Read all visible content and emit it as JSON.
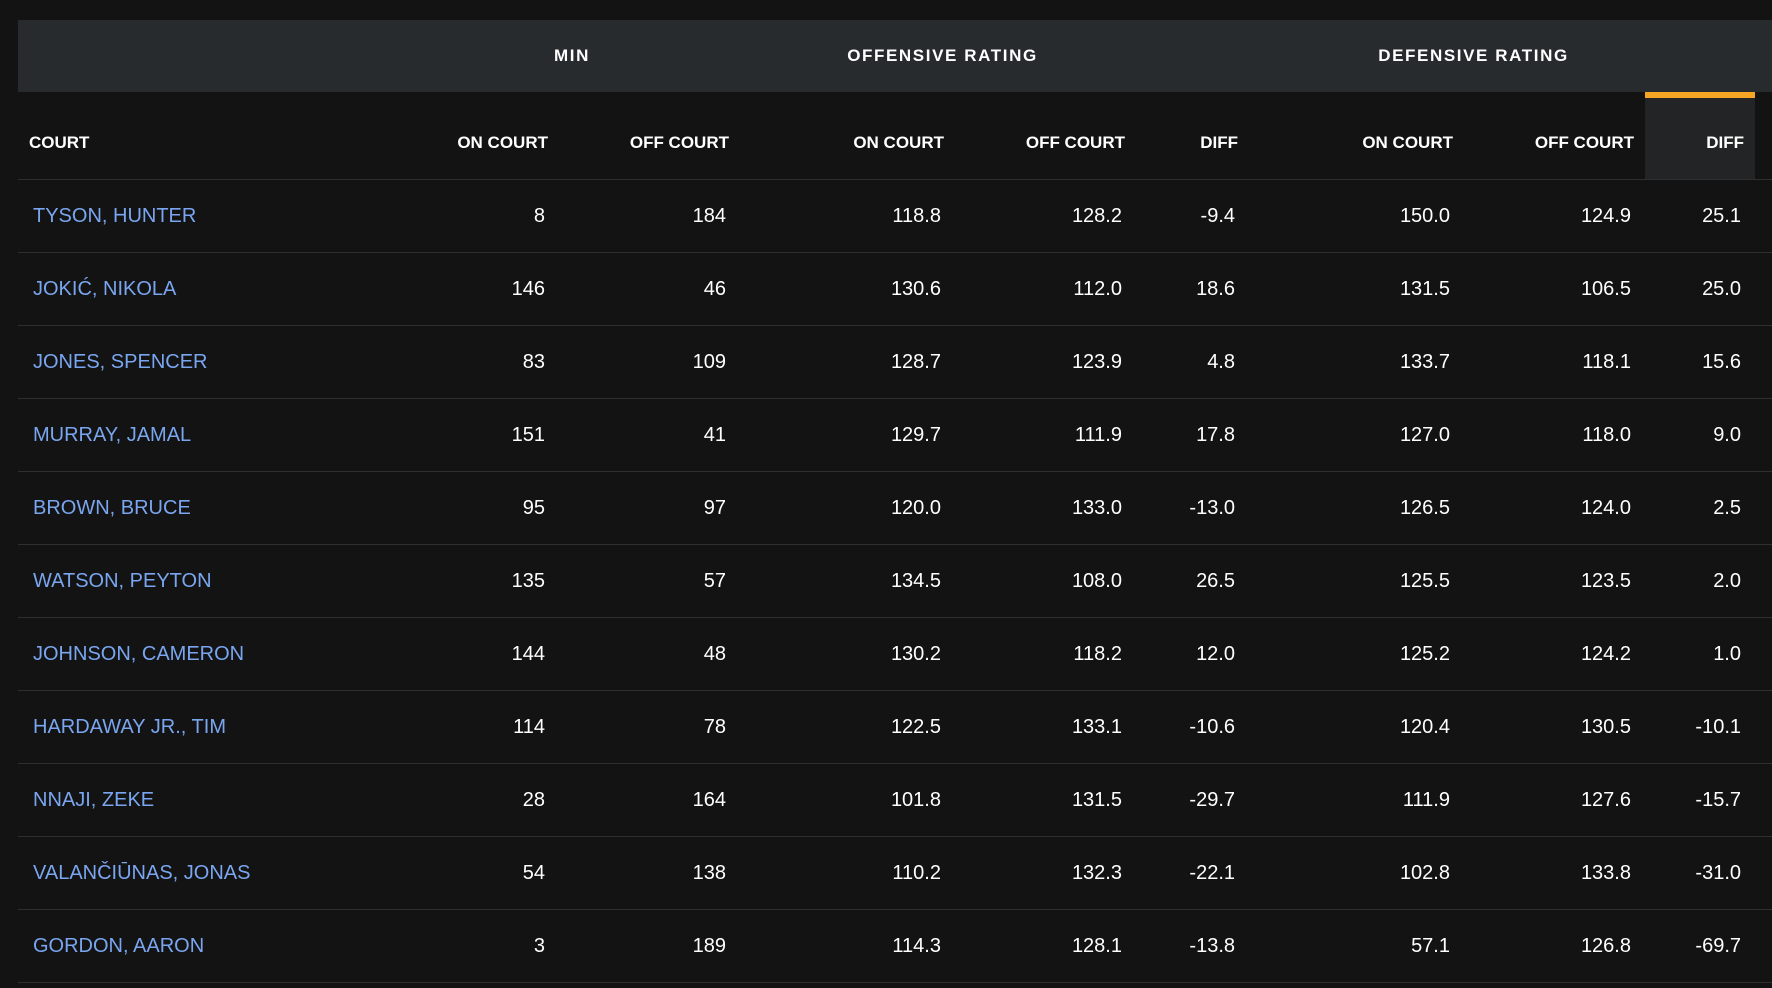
{
  "group_headers": {
    "min": "MIN",
    "offensive": "OFFENSIVE RATING",
    "defensive": "DEFENSIVE RATING"
  },
  "columns": {
    "court": "COURT",
    "min_on": "ON COURT",
    "min_off": "OFF COURT",
    "off_on": "ON COURT",
    "off_off": "OFF COURT",
    "off_diff": "DIFF",
    "def_on": "ON COURT",
    "def_off": "OFF COURT",
    "def_diff": "DIFF"
  },
  "sort": {
    "column": "def_diff",
    "accent_color": "#f5a623"
  },
  "colors": {
    "link": "#7aa6f0",
    "background": "#131313",
    "header_bg": "#282b2d"
  },
  "rows": [
    {
      "name": "TYSON, HUNTER",
      "min_on": "8",
      "min_off": "184",
      "off_on": "118.8",
      "off_off": "128.2",
      "off_diff": "-9.4",
      "def_on": "150.0",
      "def_off": "124.9",
      "def_diff": "25.1"
    },
    {
      "name": "JOKIĆ, NIKOLA",
      "min_on": "146",
      "min_off": "46",
      "off_on": "130.6",
      "off_off": "112.0",
      "off_diff": "18.6",
      "def_on": "131.5",
      "def_off": "106.5",
      "def_diff": "25.0"
    },
    {
      "name": "JONES, SPENCER",
      "min_on": "83",
      "min_off": "109",
      "off_on": "128.7",
      "off_off": "123.9",
      "off_diff": "4.8",
      "def_on": "133.7",
      "def_off": "118.1",
      "def_diff": "15.6"
    },
    {
      "name": "MURRAY, JAMAL",
      "min_on": "151",
      "min_off": "41",
      "off_on": "129.7",
      "off_off": "111.9",
      "off_diff": "17.8",
      "def_on": "127.0",
      "def_off": "118.0",
      "def_diff": "9.0"
    },
    {
      "name": "BROWN, BRUCE",
      "min_on": "95",
      "min_off": "97",
      "off_on": "120.0",
      "off_off": "133.0",
      "off_diff": "-13.0",
      "def_on": "126.5",
      "def_off": "124.0",
      "def_diff": "2.5"
    },
    {
      "name": "WATSON, PEYTON",
      "min_on": "135",
      "min_off": "57",
      "off_on": "134.5",
      "off_off": "108.0",
      "off_diff": "26.5",
      "def_on": "125.5",
      "def_off": "123.5",
      "def_diff": "2.0"
    },
    {
      "name": "JOHNSON, CAMERON",
      "min_on": "144",
      "min_off": "48",
      "off_on": "130.2",
      "off_off": "118.2",
      "off_diff": "12.0",
      "def_on": "125.2",
      "def_off": "124.2",
      "def_diff": "1.0"
    },
    {
      "name": "HARDAWAY JR., TIM",
      "min_on": "114",
      "min_off": "78",
      "off_on": "122.5",
      "off_off": "133.1",
      "off_diff": "-10.6",
      "def_on": "120.4",
      "def_off": "130.5",
      "def_diff": "-10.1"
    },
    {
      "name": "NNAJI, ZEKE",
      "min_on": "28",
      "min_off": "164",
      "off_on": "101.8",
      "off_off": "131.5",
      "off_diff": "-29.7",
      "def_on": "111.9",
      "def_off": "127.6",
      "def_diff": "-15.7"
    },
    {
      "name": "VALANČIŪNAS, JONAS",
      "min_on": "54",
      "min_off": "138",
      "off_on": "110.2",
      "off_off": "132.3",
      "off_diff": "-22.1",
      "def_on": "102.8",
      "def_off": "133.8",
      "def_diff": "-31.0"
    },
    {
      "name": "GORDON, AARON",
      "min_on": "3",
      "min_off": "189",
      "off_on": "114.3",
      "off_off": "128.1",
      "off_diff": "-13.8",
      "def_on": "57.1",
      "def_off": "126.8",
      "def_diff": "-69.7"
    }
  ]
}
